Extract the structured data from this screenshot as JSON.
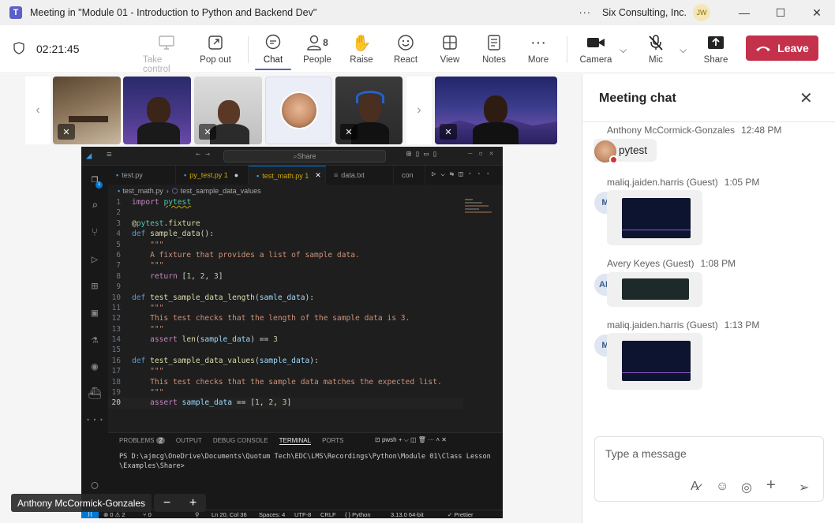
{
  "window": {
    "title": "Meeting in \"Module 01 - Introduction to Python and Backend Dev\"",
    "org": "Six Consulting, Inc.",
    "user_initials": "JW",
    "more": "···"
  },
  "toolbar": {
    "timer": "02:21:45",
    "take_control": "Take control",
    "pop_out": "Pop out",
    "chat": "Chat",
    "people": "People",
    "people_count": "8",
    "raise": "Raise",
    "react": "React",
    "view": "View",
    "notes": "Notes",
    "more": "More",
    "camera": "Camera",
    "mic": "Mic",
    "share": "Share",
    "leave": "Leave"
  },
  "presenter": {
    "name": "Anthony McCormick-Gonzales"
  },
  "vscode": {
    "search": "Share",
    "tabs": [
      "test.py",
      "py_test.py 1",
      "test_math.py 1",
      "data.txt",
      "con"
    ],
    "breadcrumb_file": "test_math.py",
    "breadcrumb_symbol": "test_sample_data_values",
    "panel_tabs": [
      "PROBLEMS",
      "OUTPUT",
      "DEBUG CONSOLE",
      "TERMINAL",
      "PORTS"
    ],
    "problems_count": "2",
    "terminal_shell": "pwsh",
    "terminal_line1": "PS D:\\ajmcg\\OneDrive\\Documents\\Quotum Tech\\EDC\\LMS\\Recordings\\Python\\Module 01\\Class Lesson",
    "terminal_line2": "\\Examples\\Share>",
    "status": {
      "errors": "⊗ 0 ⚠ 2",
      "ports": "⑂ 0",
      "position": "Ln 20, Col 36",
      "spaces": "Spaces: 4",
      "encoding": "UTF-8",
      "eol": "CRLF",
      "language": "{ } Python",
      "version": "3.13.0 64-bit",
      "prettier": "✓ Prettier"
    }
  },
  "chat": {
    "title": "Meeting chat",
    "placeholder": "Type a message",
    "messages": [
      {
        "author": "Anthony McCormick-Gonzales",
        "time": "12:48 PM",
        "text": "pytest"
      },
      {
        "author": "maliq.jaiden.harris (Guest)",
        "time": "1:05 PM",
        "initials": "M"
      },
      {
        "author": "Avery Keyes (Guest)",
        "time": "1:08 PM",
        "initials": "AK"
      },
      {
        "author": "maliq.jaiden.harris (Guest)",
        "time": "1:13 PM",
        "initials": "M"
      }
    ]
  },
  "colors": {
    "accent": "#5b5fc7",
    "leave": "#c4314b",
    "status_red": "#d13438"
  }
}
